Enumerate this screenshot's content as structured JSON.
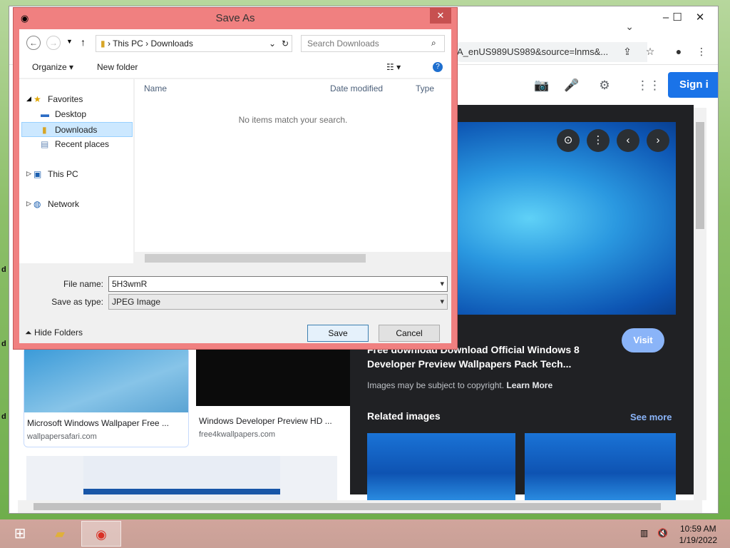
{
  "desktop": {
    "fragments": [
      "d",
      "d",
      "d"
    ]
  },
  "chrome": {
    "omnibox_text": "A_enUS989US989&source=lnms&...",
    "controls": {
      "minimize": "–",
      "maximize": "☐",
      "close": "✕",
      "tab_list": "⌄"
    },
    "signin_label": "Sign i",
    "results": [
      {
        "title": "Microsoft Windows Wallpaper Free ...",
        "source": "wallpapersafari.com"
      },
      {
        "title": "Windows Developer Preview HD ...",
        "source": "free4kwallpapers.com"
      }
    ],
    "preview": {
      "visit_label": "Visit",
      "title": "Free download Download Official Windows 8 Developer Preview Wallpapers Pack Tech...",
      "copyright_text": "Images may be subject to copyright.",
      "learn_more": "Learn More",
      "related_label": "Related images",
      "see_more": "See more"
    }
  },
  "dialog": {
    "title": "Save As",
    "close": "✕",
    "breadcrumb": {
      "root": "This PC",
      "sep": "›",
      "folder": "Downloads"
    },
    "search_placeholder": "Search Downloads",
    "toolbar": {
      "organize": "Organize ▾",
      "new_folder": "New folder"
    },
    "nav": {
      "favorites": "Favorites",
      "desktop": "Desktop",
      "downloads": "Downloads",
      "recent": "Recent places",
      "this_pc": "This PC",
      "network": "Network"
    },
    "columns": {
      "name": "Name",
      "date_modified": "Date modified",
      "type": "Type"
    },
    "empty_message": "No items match your search.",
    "file_name_label": "File name:",
    "file_name_value": "5H3wmR",
    "save_type_label": "Save as type:",
    "save_type_value": "JPEG Image",
    "hide_folders": "Hide Folders",
    "save_button": "Save",
    "cancel_button": "Cancel"
  },
  "taskbar": {
    "time": "10:59 AM",
    "date": "1/19/2022"
  },
  "colors": {
    "dialog_frame": "#f08080",
    "accent": "#1a73e8",
    "preview_bg": "#202124",
    "taskbar": "#d1a59c"
  }
}
